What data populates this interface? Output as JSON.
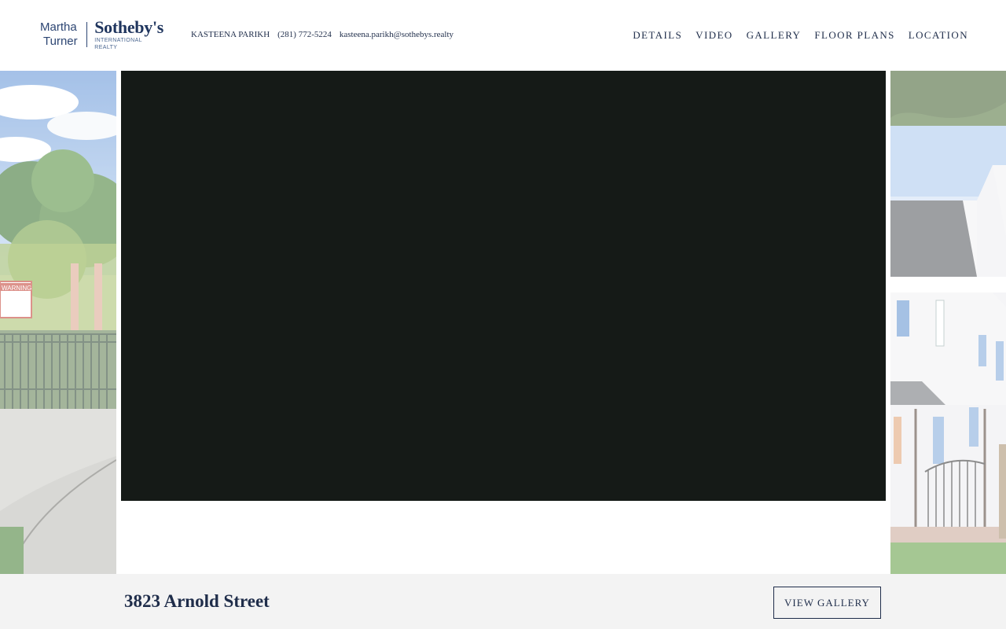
{
  "logo": {
    "left_line1": "Martha",
    "left_line2": "Turner",
    "right_big": "Sotheby's",
    "right_small": "INTERNATIONAL REALTY"
  },
  "agent": {
    "name": "KASTEENA PARIKH",
    "phone": "(281) 772-5224",
    "email": "kasteena.parikh@sothebys.realty"
  },
  "nav": {
    "details": "DETAILS",
    "video": "VIDEO",
    "gallery": "GALLERY",
    "floor_plans": "FLOOR PLANS",
    "location": "LOCATION"
  },
  "gallery": {
    "left_sign_text": "WARNING",
    "video_state": "black video player"
  },
  "footer": {
    "address": "3823 Arnold Street",
    "view_gallery": "VIEW GALLERY"
  },
  "colors": {
    "brand_navy": "#1f2d4a",
    "video_bg": "#151a17",
    "footer_bg": "#f3f3f3"
  }
}
